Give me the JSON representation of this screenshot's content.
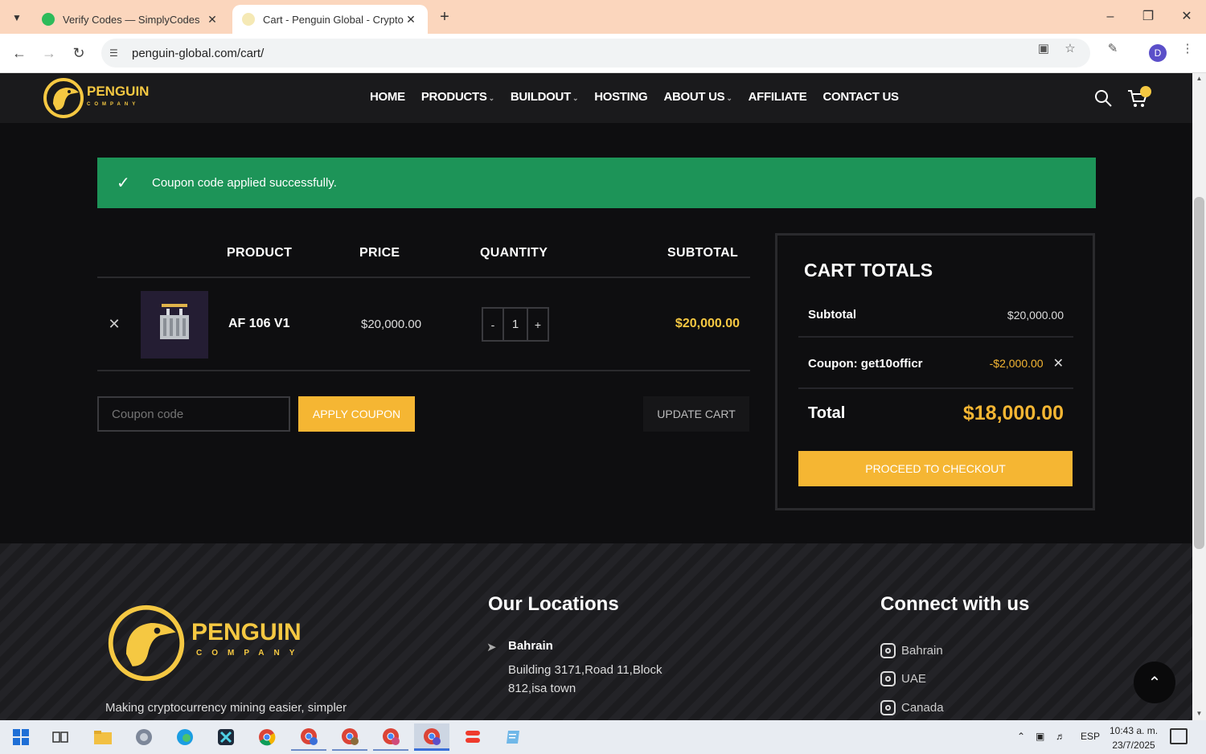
{
  "browser": {
    "tabs": [
      {
        "title": "Verify Codes — SimplyCodes",
        "active": false
      },
      {
        "title": "Cart - Penguin Global - Crypto Mining",
        "active": true
      }
    ],
    "url": "penguin-global.com/cart/",
    "profile_initial": "D"
  },
  "site": {
    "logo_text": "PENGUIN",
    "logo_sub": "COMPANY",
    "nav": [
      {
        "label": "HOME",
        "dropdown": false
      },
      {
        "label": "PRODUCTS",
        "dropdown": true
      },
      {
        "label": "BUILDOUT",
        "dropdown": true
      },
      {
        "label": "HOSTING",
        "dropdown": false
      },
      {
        "label": "ABOUT US",
        "dropdown": true
      },
      {
        "label": "AFFILIATE",
        "dropdown": false
      },
      {
        "label": "CONTACT US",
        "dropdown": false
      }
    ]
  },
  "notice": {
    "message": "Coupon code applied successfully.",
    "color": "#1d9458"
  },
  "cart": {
    "headers": {
      "product": "PRODUCT",
      "price": "PRICE",
      "quantity": "QUANTITY",
      "subtotal": "SUBTOTAL"
    },
    "items": [
      {
        "name": "AF 106 V1",
        "price": "$20,000.00",
        "quantity": "1",
        "subtotal": "$20,000.00",
        "qty_minus": "-",
        "qty_plus": "+"
      }
    ],
    "coupon_placeholder": "Coupon code",
    "apply_label": "APPLY COUPON",
    "update_label": "UPDATE CART"
  },
  "totals": {
    "title": "CART TOTALS",
    "subtotal_label": "Subtotal",
    "subtotal_value": "$20,000.00",
    "coupon_label": "Coupon: get10officr",
    "coupon_value": "-$2,000.00",
    "total_label": "Total",
    "total_value": "$18,000.00",
    "checkout_label": "PROCEED TO CHECKOUT"
  },
  "footer": {
    "logo_text": "PENGUIN",
    "logo_sub": "COMPANY",
    "tagline": "Making cryptocurrency mining easier, simpler",
    "locations_heading": "Our Locations",
    "location": {
      "name": "Bahrain",
      "address": "Building 3171,Road 11,Block 812,isa town"
    },
    "connect_heading": "Connect with us",
    "social": [
      "Bahrain",
      "UAE",
      "Canada"
    ]
  },
  "taskbar": {
    "language": "ESP",
    "time": "10:43 a. m.",
    "date": "23/7/2025"
  },
  "colors": {
    "accent": "#f5b633",
    "success": "#1d9458",
    "background": "#0e0e10"
  }
}
